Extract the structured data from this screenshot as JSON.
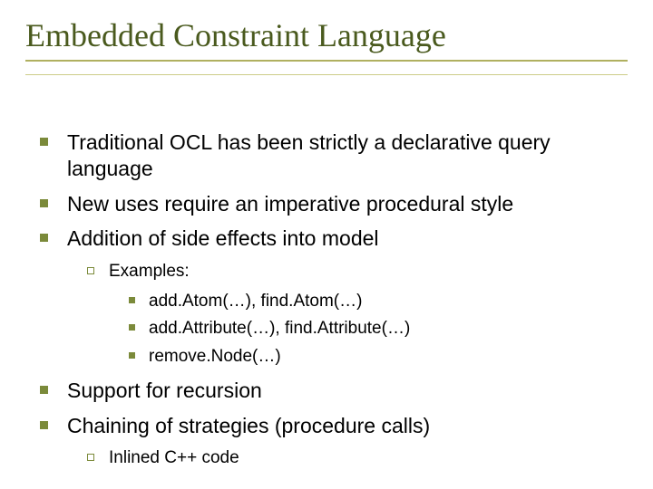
{
  "title": "Embedded Constraint Language",
  "bullets": {
    "b1": "Traditional OCL has been strictly a declarative query language",
    "b2": "New uses require an imperative procedural style",
    "b3": "Addition of side effects into model",
    "examples_label": "Examples:",
    "ex1": "add.Atom(…), find.Atom(…)",
    "ex2": "add.Attribute(…), find.Attribute(…)",
    "ex3": "remove.Node(…)",
    "b4": "Support for recursion",
    "b5": "Chaining of strategies (procedure calls)",
    "inlined": "Inlined C++ code"
  }
}
